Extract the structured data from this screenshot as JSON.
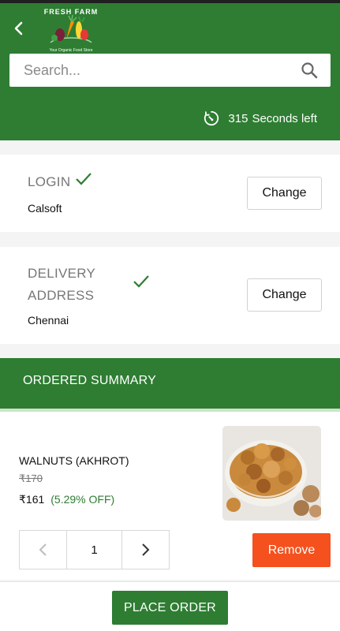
{
  "brand": {
    "name": "FRESH FARM",
    "tagline": "Your Organic Food Store"
  },
  "search": {
    "placeholder": "Search..."
  },
  "timer": {
    "seconds": "315",
    "label": "Seconds left"
  },
  "login": {
    "title": "LOGIN",
    "value": "Calsoft",
    "change_label": "Change"
  },
  "delivery": {
    "title_line1": "DELIVERY",
    "title_line2": "ADDRESS",
    "value": "Chennai",
    "change_label": "Change"
  },
  "summary": {
    "title": "ORDERED SUMMARY"
  },
  "item": {
    "name": "WALNUTS (AKHROT)",
    "mrp": "₹170",
    "price": "₹161",
    "discount": "(5.29% OFF)",
    "quantity": "1",
    "remove_label": "Remove",
    "image_icon": "walnuts-bowl-image"
  },
  "footer": {
    "place_order_label": "PLACE ORDER"
  },
  "colors": {
    "primary_green": "#2e7d32",
    "remove_orange": "#f4511e",
    "discount_green": "#2e7d32"
  }
}
